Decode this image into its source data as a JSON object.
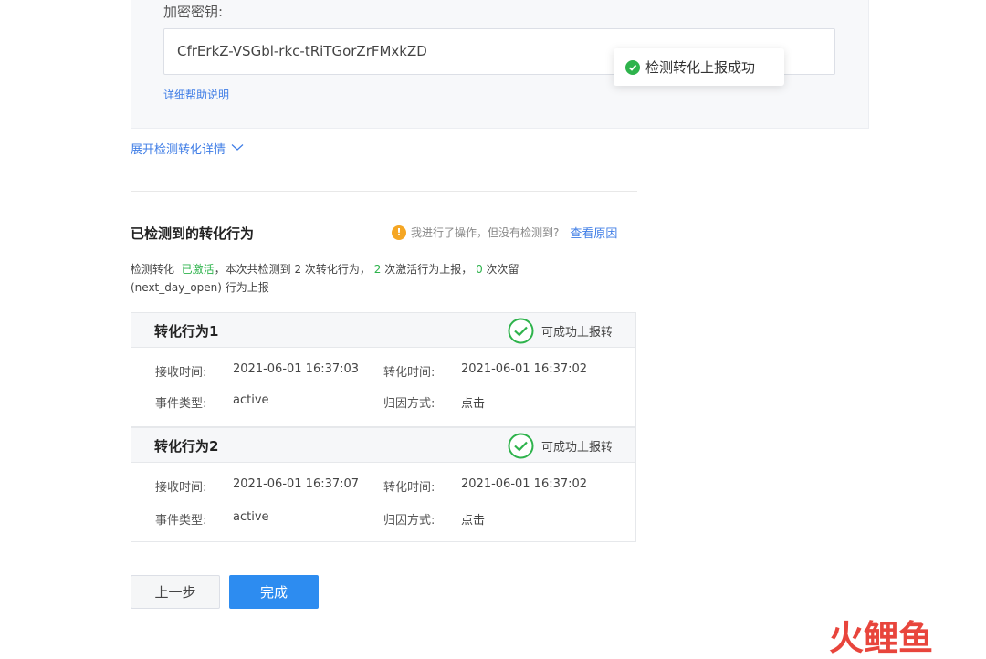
{
  "encryption": {
    "label": "加密密钥:",
    "value": "CfrErkZ-VSGbl-rkc-tRiTGorZrFMxkZD",
    "help_link": "详细帮助说明"
  },
  "toast": {
    "message": "检测转化上报成功"
  },
  "expand_link": "展开检测转化详情",
  "section": {
    "title": "已检测到的转化行为",
    "hint": "我进行了操作，但没有检测到?",
    "hint_link": "查看原因"
  },
  "summary": {
    "prefix": "检测转化",
    "status": "已激活",
    "mid": "，本次共检测到 2 次转化行为，",
    "active_count": "2",
    "active_text": "次激活行为上报，",
    "retention_count": "0",
    "retention_text": "次次留",
    "line2": "(next_day_open) 行为上报"
  },
  "cards": [
    {
      "title": "转化行为1",
      "status": "可成功上报转",
      "receive_label": "接收时间:",
      "receive_time": "2021-06-01 16:37:03",
      "convert_label": "转化时间:",
      "convert_time": "2021-06-01 16:37:02",
      "event_label": "事件类型:",
      "event_type": "active",
      "attr_label": "归因方式:",
      "attr_method": "点击"
    },
    {
      "title": "转化行为2",
      "status": "可成功上报转",
      "receive_label": "接收时间:",
      "receive_time": "2021-06-01 16:37:07",
      "convert_label": "转化时间:",
      "convert_time": "2021-06-01 16:37:02",
      "event_label": "事件类型:",
      "event_type": "active",
      "attr_label": "归因方式:",
      "attr_method": "点击"
    }
  ],
  "buttons": {
    "prev": "上一步",
    "done": "完成"
  },
  "watermark": {
    "text": "火鲤鱼"
  },
  "colors": {
    "primary": "#2d8cf0",
    "link": "#3f7de6",
    "success": "#2eb34c",
    "warning": "#f5a623",
    "watermark_red": "#e8453c",
    "watermark_blue": "#3b7bd6"
  }
}
